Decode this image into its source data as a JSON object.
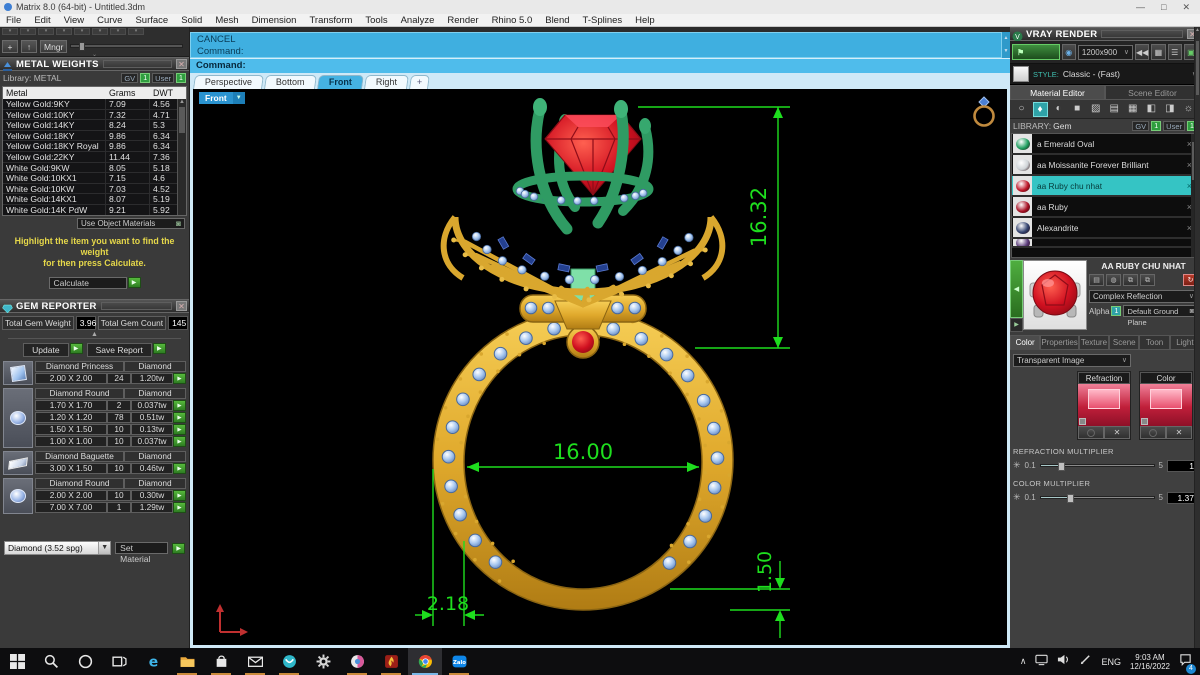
{
  "window": {
    "title": "Matrix 8.0 (64-bit) - Untitled.3dm"
  },
  "menu": {
    "items": [
      "File",
      "Edit",
      "View",
      "Curve",
      "Surface",
      "Solid",
      "Mesh",
      "Dimension",
      "Transform",
      "Tools",
      "Analyze",
      "Render",
      "Rhino 5.0",
      "Blend",
      "T-Splines",
      "Help"
    ]
  },
  "toolbar": {
    "buttons": [
      "+",
      "↑",
      "Mngr"
    ]
  },
  "metal_weights": {
    "title": "METAL WEIGHTS",
    "library_label": "Library:  METAL",
    "toggles": {
      "gv": "GV",
      "user": "User",
      "on": "1"
    },
    "columns": [
      "Metal",
      "Grams",
      "DWT"
    ],
    "rows": [
      [
        "Yellow Gold:9KY",
        "7.09",
        "4.56"
      ],
      [
        "Yellow Gold:10KY",
        "7.32",
        "4.71"
      ],
      [
        "Yellow Gold:14KY",
        "8.24",
        "5.3"
      ],
      [
        "Yellow Gold:18KY",
        "9.86",
        "6.34"
      ],
      [
        "Yellow Gold:18KY Royal",
        "9.86",
        "6.34"
      ],
      [
        "Yellow Gold:22KY",
        "11.44",
        "7.36"
      ],
      [
        "White Gold:9KW",
        "8.05",
        "5.18"
      ],
      [
        "White Gold:10KX1",
        "7.15",
        "4.6"
      ],
      [
        "White Gold:10KW",
        "7.03",
        "4.52"
      ],
      [
        "White Gold:14KX1",
        "8.07",
        "5.19"
      ],
      [
        "White Gold:14K PdW",
        "9.21",
        "5.92"
      ]
    ],
    "use_object_materials": "Use Object Materials",
    "instruction_line1": "Highlight the item you want to find the weight",
    "instruction_line2": "for then press Calculate.",
    "calculate_label": "Calculate"
  },
  "gem_reporter": {
    "title": "GEM REPORTER",
    "total_weight_label": "Total Gem Weight",
    "total_weight": "3.96",
    "total_count_label": "Total Gem Count",
    "total_count": "145",
    "update_label": "Update",
    "save_report_label": "Save Report",
    "groups": [
      {
        "shape": "princess",
        "name": "Diamond Princess",
        "type": "Diamond",
        "rows": [
          [
            "2.00 X 2.00",
            "24",
            "1.20tw"
          ]
        ]
      },
      {
        "shape": "round",
        "name": "Diamond Round",
        "type": "Diamond",
        "rows": [
          [
            "1.70 X 1.70",
            "2",
            "0.037tw"
          ],
          [
            "1.20 X 1.20",
            "78",
            "0.51tw"
          ],
          [
            "1.50 X 1.50",
            "10",
            "0.13tw"
          ],
          [
            "1.00 X 1.00",
            "10",
            "0.037tw"
          ]
        ]
      },
      {
        "shape": "baguette",
        "name": "Diamond Baguette",
        "type": "Diamond",
        "rows": [
          [
            "3.00 X 1.50",
            "10",
            "0.46tw"
          ]
        ]
      },
      {
        "shape": "round",
        "name": "Diamond Round",
        "type": "Diamond",
        "rows": [
          [
            "2.00 X 2.00",
            "10",
            "0.30tw"
          ],
          [
            "7.00 X 7.00",
            "1",
            "1.29tw"
          ]
        ]
      }
    ],
    "material_select": "Diamond    (3.52 spg)",
    "set_material_label": "Set Material"
  },
  "command": {
    "history": [
      "CANCEL",
      "Command:"
    ],
    "prompt": "Command:"
  },
  "viewport": {
    "tabs": [
      "Perspective",
      "Bottom",
      "Front",
      "Right"
    ],
    "add_tab": "+",
    "active_tab": "Front",
    "view_label": "Front",
    "dimensions": {
      "height": "16.32",
      "inner_diameter": "16.00",
      "band_width": "2.18",
      "band_thickness": "1.50"
    },
    "dim_color": "#1ede1e"
  },
  "vray": {
    "title": "VRAY RENDER",
    "render_label": "RENDER",
    "resolution": "1200x900",
    "style_label": "STYLE:",
    "style_value": "Classic - (Fast)"
  },
  "material_editor": {
    "tabs": [
      "Material Editor",
      "Scene Editor"
    ],
    "library_label": "LIBRARY:",
    "library_value": "Gem",
    "toggles": {
      "gv": "GV",
      "user": "User",
      "on": "1"
    },
    "tool_icons": [
      "metal",
      "gem",
      "ball",
      "plain",
      "hatch",
      "shade",
      "pattern",
      "swap-left",
      "swap-right",
      "light"
    ],
    "items": [
      {
        "label": "a Emerald Oval",
        "color": "#1f9f60",
        "selected": false
      },
      {
        "label": "aa Moissanite Forever Brilliant",
        "color": "#cfd4d8",
        "selected": false
      },
      {
        "label": "aa Ruby chu nhat",
        "color": "#c0182a",
        "selected": true
      },
      {
        "label": "aa Ruby",
        "color": "#a81225",
        "selected": false
      },
      {
        "label": "Alexandrite",
        "color": "#31416e",
        "selected": false
      },
      {
        "label": "",
        "color": "#5a3b7a",
        "selected": false,
        "partial": true
      }
    ],
    "preview_title": "AA RUBY CHU NHAT",
    "reflection_value": "Complex Reflection",
    "alpha_label": "Alpha",
    "ground_plane_value": "Default Ground Plane",
    "prop_tabs": [
      "Color",
      "Properties",
      "Texture",
      "Scene",
      "Toon",
      "Light"
    ],
    "active_prop_tab": "Color",
    "transparent_value": "Transparent Image",
    "swatches": [
      "Refraction",
      "Color"
    ],
    "refraction_multiplier": {
      "label": "REFRACTION MULTIPLIER",
      "min": "0.1",
      "max": "5",
      "value": "1"
    },
    "color_multiplier": {
      "label": "COLOR MULTIPLIER",
      "min": "0.1",
      "max": "5",
      "value": "1.37"
    }
  },
  "taskbar": {
    "icons": [
      {
        "name": "start",
        "running": false
      },
      {
        "name": "search",
        "running": false
      },
      {
        "name": "cortana",
        "running": false
      },
      {
        "name": "task-view",
        "running": false
      },
      {
        "name": "edge",
        "running": false
      },
      {
        "name": "file-explorer",
        "running": true
      },
      {
        "name": "store",
        "running": true
      },
      {
        "name": "mail",
        "running": true
      },
      {
        "name": "teal-app",
        "running": true
      },
      {
        "name": "settings",
        "running": false
      },
      {
        "name": "paint-3d",
        "running": true
      },
      {
        "name": "game",
        "running": true
      },
      {
        "name": "chrome",
        "running": true,
        "active": true
      },
      {
        "name": "zalo",
        "label": "Zalo",
        "running": true
      }
    ],
    "tray": {
      "lang": "ENG",
      "time": "9:03 AM",
      "date": "12/16/2022",
      "badge": "4"
    }
  }
}
